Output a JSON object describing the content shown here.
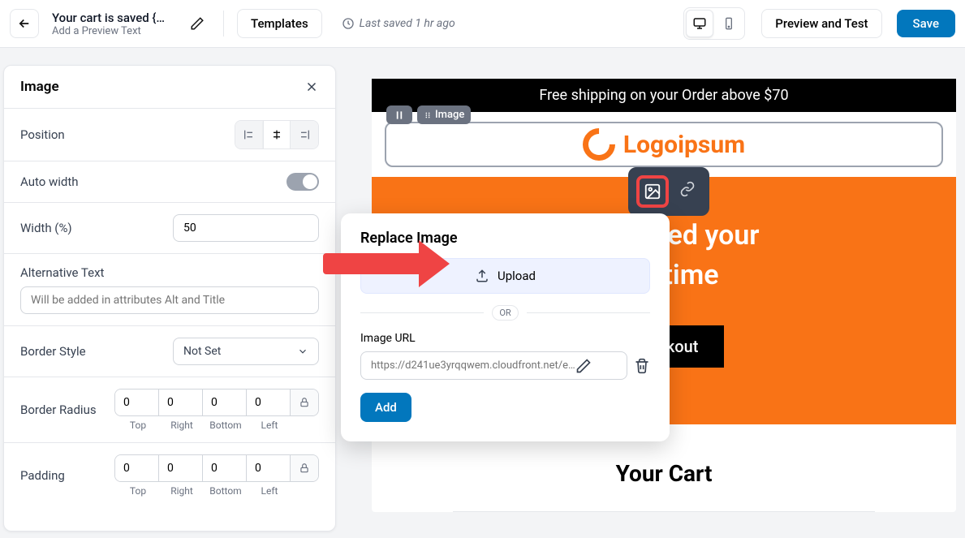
{
  "topbar": {
    "title": "Your cart is saved {…",
    "subtitle": "Add a Preview Text",
    "templates_label": "Templates",
    "last_saved": "Last saved 1 hr ago",
    "preview_label": "Preview and Test",
    "save_label": "Save"
  },
  "sidebar": {
    "title": "Image",
    "position_label": "Position",
    "auto_width_label": "Auto width",
    "width_label": "Width (%)",
    "width_value": "50",
    "alt_text_label": "Alternative Text",
    "alt_text_placeholder": "Will be added in attributes Alt and Title",
    "border_style_label": "Border Style",
    "border_style_value": "Not Set",
    "border_radius_label": "Border Radius",
    "padding_label": "Padding",
    "quad_labels": {
      "top": "Top",
      "right": "Right",
      "bottom": "Bottom",
      "left": "Left"
    },
    "border_radius": {
      "top": "0",
      "right": "0",
      "bottom": "0",
      "left": "0"
    },
    "padding": {
      "top": "0",
      "right": "0",
      "bottom": "0",
      "left": "0"
    }
  },
  "popup": {
    "title": "Replace Image",
    "upload_label": "Upload",
    "or_label": "OR",
    "url_label": "Image URL",
    "url_placeholder": "https://d241ue3yrqqwem.cloudfront.net/e…",
    "add_label": "Add"
  },
  "canvas": {
    "banner": "Free shipping on your Order above $70",
    "pill_label": "Image",
    "logo_text": "Logoipsum",
    "hero_line1": "e reserved your",
    "hero_line2": "ometime",
    "checkout_label": "Checkout",
    "cart_title": "Your Cart"
  }
}
